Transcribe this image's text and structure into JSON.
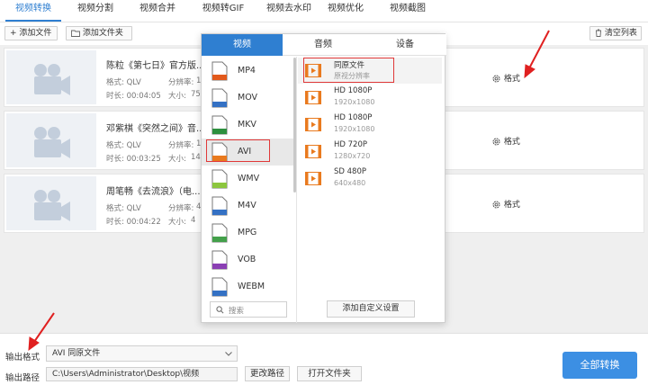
{
  "tabs": [
    "视频转换",
    "视频分割",
    "视频合并",
    "视频转GIF",
    "视频去水印",
    "视频优化",
    "视频截图"
  ],
  "toolbar": {
    "add_file": "添加文件",
    "add_folder": "添加文件夹",
    "clear_list": "清空列表"
  },
  "files": [
    {
      "title": "陈粒《第七日》官方版...)",
      "format_label": "格式: QLV",
      "res_label": "分辨率:",
      "res_value": "1",
      "duration_label": "时长: 00:04:05",
      "size_label": "大小:",
      "size_value": "75",
      "settings_label": "格式"
    },
    {
      "title": "邓紫棋《突然之间》音...)",
      "format_label": "格式: QLV",
      "res_label": "分辨率:",
      "res_value": "1",
      "duration_label": "时长: 00:03:25",
      "size_label": "大小:",
      "size_value": "14",
      "settings_label": "格式"
    },
    {
      "title": "周笔畅《去流浪》（电...)",
      "format_label": "格式: QLV",
      "res_label": "分辨率:",
      "res_value": "4",
      "duration_label": "时长: 00:04:22",
      "size_label": "大小:",
      "size_value": "4",
      "settings_label": "格式"
    }
  ],
  "popup": {
    "tabs": [
      "视频",
      "音频",
      "设备"
    ],
    "formats": [
      {
        "name": "MP4",
        "color": "#e2591b"
      },
      {
        "name": "MOV",
        "color": "#3471c4"
      },
      {
        "name": "MKV",
        "color": "#2d8f3e"
      },
      {
        "name": "AVI",
        "color": "#e97a1e"
      },
      {
        "name": "WMV",
        "color": "#8cc63e"
      },
      {
        "name": "M4V",
        "color": "#3471c4"
      },
      {
        "name": "MPG",
        "color": "#43a04a"
      },
      {
        "name": "VOB",
        "color": "#8a3fb3"
      },
      {
        "name": "WEBM",
        "color": "#3471c4"
      }
    ],
    "resolutions": [
      {
        "name": "同原文件",
        "sub": "原视分辨率"
      },
      {
        "name": "HD 1080P",
        "sub": "1920x1080"
      },
      {
        "name": "HD 1080P",
        "sub": "1920x1080"
      },
      {
        "name": "HD 720P",
        "sub": "1280x720"
      },
      {
        "name": "SD 480P",
        "sub": "640x480"
      }
    ],
    "search_placeholder": "搜索",
    "custom_button": "添加自定义设置"
  },
  "bottom": {
    "output_format_label": "输出格式",
    "output_format_value": "AVI  同原文件",
    "output_path_label": "输出路径",
    "output_path_value": "C:\\Users\\Administrator\\Desktop\\视频",
    "change_path": "更改路径",
    "open_folder": "打开文件夹",
    "convert_all": "全部转换"
  },
  "colors": {
    "accent": "#2f7fd1",
    "convert_button": "#3c8fe3",
    "highlight_box": "#e03838",
    "annotation_arrow": "#e02020"
  }
}
